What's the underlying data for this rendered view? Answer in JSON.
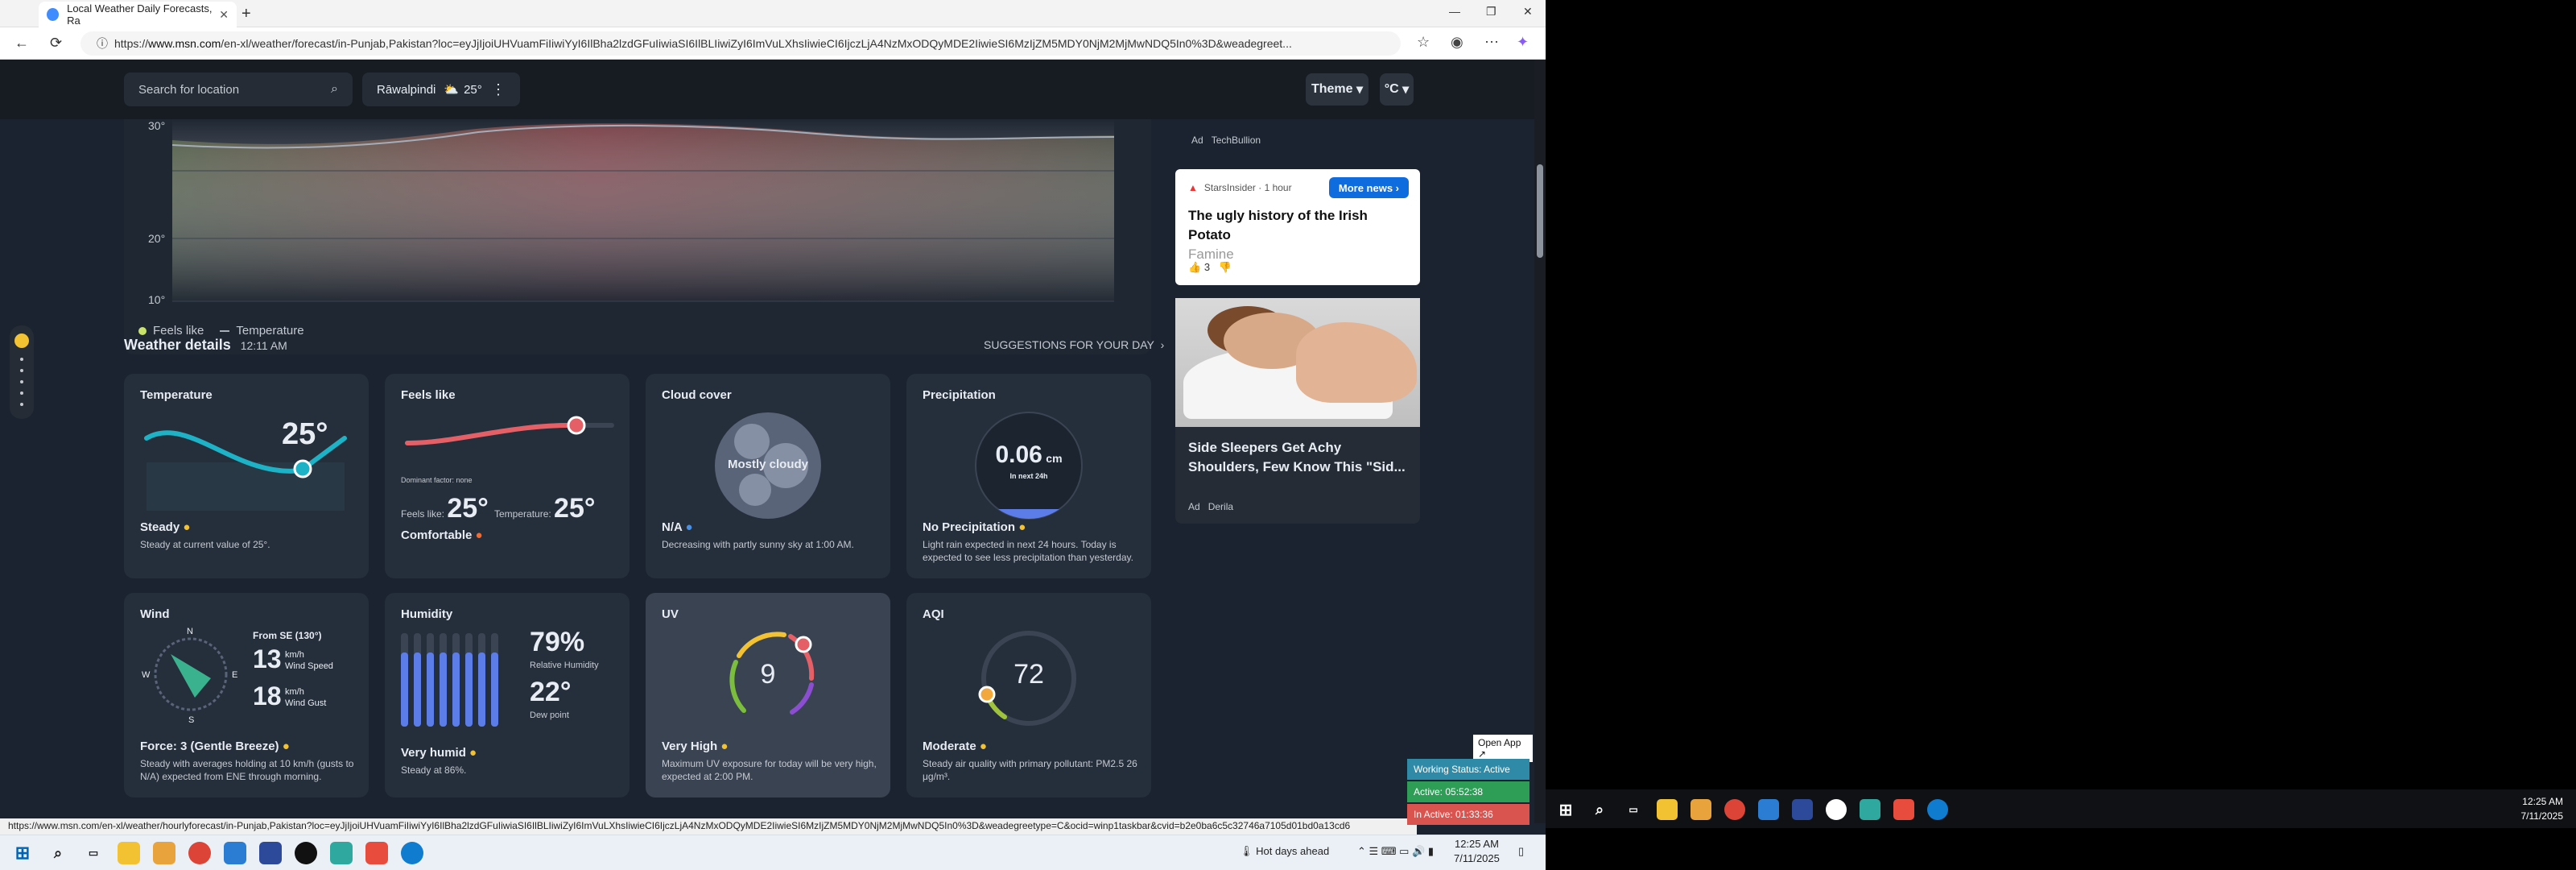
{
  "browser": {
    "tab_title": "Local Weather Daily Forecasts, Ra",
    "url_prefix": "https://",
    "url_domain": "www.msn.com",
    "url_rest": "/en-xl/weather/forecast/in-Punjab,Pakistan?loc=eyJjIjoiUHVuamFiIiwiYyI6IlBha2lzdGFuIiwiaSI6IlBLIiwiZyI6ImVuLXhsIiwieCI6IjczLjA4NzMxODQyMDE2IiwieSI6MzIjZM5MDY0NjM2MjMwNDQ5In0%3D&weadegreet..."
  },
  "header": {
    "search_placeholder": "Search for location",
    "location": "Rāwalpindi",
    "location_temp": "25°",
    "theme_label": "Theme",
    "unit_label": "°C"
  },
  "chart": {
    "y_labels": [
      "30°",
      "20°",
      "10°"
    ],
    "legend_feels": "Feels like",
    "legend_temp": "Temperature"
  },
  "sidebar": {
    "ad1_label": "Ad",
    "ad1_source": "TechBullion",
    "news_source": "StarsInsider · 1 hour",
    "more_news": "More news",
    "news_title_a": "The ugly history of the Irish Potato",
    "news_title_b": "Famine",
    "news_likes": "3",
    "ad2_title": "Side Sleepers Get Achy Shoulders, Few Know This \"Sid...",
    "ad2_label": "Ad",
    "ad2_source": "Derila"
  },
  "details": {
    "heading": "Weather details",
    "time": "12:11 AM",
    "suggestions": "SUGGESTIONS FOR YOUR DAY"
  },
  "cards": {
    "temperature": {
      "title": "Temperature",
      "value": "25°",
      "status": "Steady",
      "desc": "Steady at current value of 25°."
    },
    "feels": {
      "title": "Feels like",
      "factor": "Dominant factor: none",
      "feels_label": "Feels like:",
      "feels_value": "25°",
      "temp_label": "Temperature:",
      "temp_value": "25°",
      "status": "Comfortable"
    },
    "cloud": {
      "title": "Cloud cover",
      "center": "Mostly cloudy",
      "status": "N/A",
      "desc": "Decreasing with partly sunny sky at 1:00 AM."
    },
    "precip": {
      "title": "Precipitation",
      "value": "0.06",
      "unit": "cm",
      "sub": "In next 24h",
      "status": "No Precipitation",
      "desc": "Light rain expected in next 24 hours. Today is expected to see less precipitation than yesterday."
    },
    "wind": {
      "title": "Wind",
      "from": "From SE (130°)",
      "speed": "13",
      "speed_unit": "km/h",
      "speed_label": "Wind Speed",
      "gust": "18",
      "gust_unit": "km/h",
      "gust_label": "Wind Gust",
      "n": "N",
      "e": "E",
      "s": "S",
      "w": "W",
      "status": "Force: 3 (Gentle Breeze)",
      "desc": "Steady with averages holding at 10 km/h (gusts to N/A) expected from ENE through morning."
    },
    "humidity": {
      "title": "Humidity",
      "rh": "79%",
      "rh_label": "Relative Humidity",
      "dew": "22°",
      "dew_label": "Dew point",
      "status": "Very humid",
      "desc": "Steady at 86%."
    },
    "uv": {
      "title": "UV",
      "value": "9",
      "status": "Very High",
      "desc": "Maximum UV exposure for today will be very high, expected at 2:00 PM."
    },
    "aqi": {
      "title": "AQI",
      "value": "72",
      "status": "Moderate",
      "desc": "Steady air quality with primary pollutant: PM2.5 26 μg/m³."
    }
  },
  "statusbar": "https://www.msn.com/en-xl/weather/hourlyforecast/in-Punjab,Pakistan?loc=eyJjIjoiUHVuamFiIiwiYyI6IlBha2lzdGFuIiwiaSI6IlBLIiwiZyI6ImVuLXhsIiwieCI6IjczLjA4NzMxODQyMDE2IiwieSI6MzIjZM5MDY0NjM2MjMwNDQ5In0%3D&weadegreetype=C&ocid=winp1taskbar&cvid=b2e0ba6c5c32746a7105d01bd0a13cd6",
  "popup": {
    "open": "Open App ↗",
    "working": "Working Status: Active",
    "active": "Active: 05:52:38",
    "inactive": "In Active: 01:33:36"
  },
  "taskbar1": {
    "weather": "Hot days ahead",
    "time": "12:25 AM",
    "date": "7/11/2025"
  },
  "taskbar2": {
    "time": "12:25 AM",
    "date": "7/11/2025"
  }
}
